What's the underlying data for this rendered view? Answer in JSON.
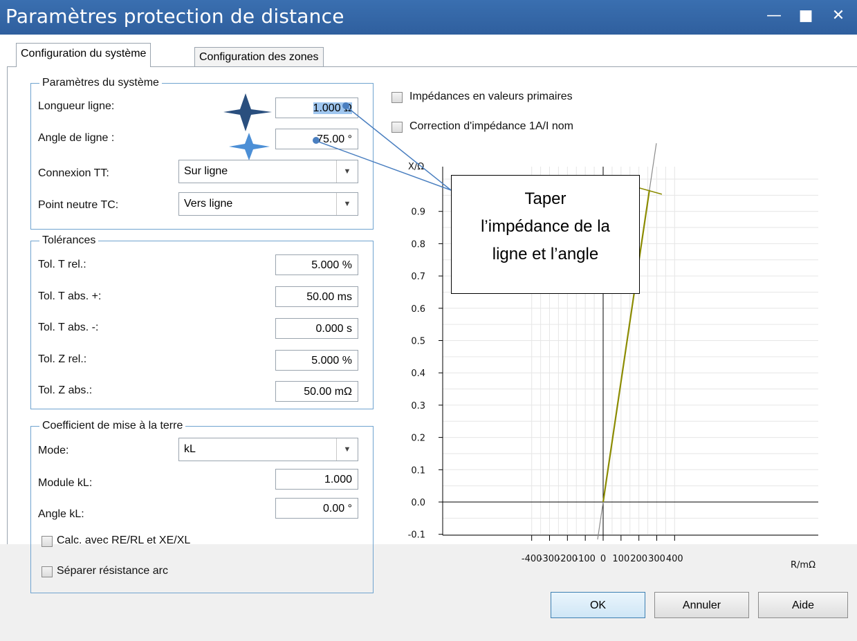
{
  "window": {
    "title": "Paramètres protection de distance",
    "minimize_icon": "minimize-icon",
    "maximize_icon": "maximize-icon",
    "close_icon": "close-icon"
  },
  "tabs": [
    {
      "label": "Configuration du système",
      "active": true
    },
    {
      "label": "Configuration des zones",
      "active": false
    }
  ],
  "system_group": {
    "legend": "Paramètres du système",
    "line_length_label": "Longueur ligne:",
    "line_length_value": "1.000 Ω",
    "line_angle_label": "Angle de ligne :",
    "line_angle_value": "75.00 °",
    "vt_label": "Connexion TT:",
    "vt_value": "Sur ligne",
    "ct_label": "Point neutre TC:",
    "ct_value": "Vers ligne"
  },
  "tolerances": {
    "legend": "Tolérances",
    "rows": [
      {
        "label": "Tol. T rel.:",
        "value": "5.000 %"
      },
      {
        "label": "Tol. T abs. +:",
        "value": "50.00 ms"
      },
      {
        "label": "Tol. T abs. -:",
        "value": "0.000 s"
      },
      {
        "label": "Tol. Z rel.:",
        "value": "5.000 %"
      },
      {
        "label": "Tol. Z abs.:",
        "value": "50.00 mΩ"
      }
    ]
  },
  "earth": {
    "legend": "Coefficient de mise à la terre",
    "mode_label": "Mode:",
    "mode_value": "kL",
    "module_label": "Module kL:",
    "module_value": "1.000",
    "angle_label": "Angle kL:",
    "angle_value": "0.00 °",
    "calc_label": "Calc. avec RE/RL et XE/XL",
    "calc_checked": false,
    "arc_label": "Séparer résistance arc",
    "arc_checked": false
  },
  "options": {
    "primary_label": "Impédances en valeurs primaires",
    "primary_checked": false,
    "correction_label": "Correction d'impédance 1A/I nom",
    "correction_checked": false
  },
  "callout": {
    "lines": [
      "Taper",
      "l’impédance de la",
      "ligne et l’angle"
    ]
  },
  "buttons": {
    "ok": "OK",
    "cancel": "Annuler",
    "help": "Aide"
  },
  "colors": {
    "titlebar": "#2f5f9e",
    "group_border": "#6fa3cf",
    "arrow": "#4a7fc0",
    "impedance_line": "#8b8b00"
  },
  "chart_data": {
    "type": "line",
    "xlabel": "R/mΩ",
    "ylabel": "X/Ω",
    "xlim": [
      -450,
      450
    ],
    "ylim": [
      -0.1,
      1.0
    ],
    "xticks": [
      -400,
      -300,
      -200,
      -100,
      0,
      100,
      200,
      300,
      400
    ],
    "yticks": [
      -0.1,
      0.0,
      0.1,
      0.2,
      0.3,
      0.4,
      0.5,
      0.6,
      0.7,
      0.8,
      0.9
    ],
    "grid": true,
    "series": [
      {
        "x": [
          0,
          259
        ],
        "y": [
          0,
          0.966
        ]
      }
    ]
  }
}
